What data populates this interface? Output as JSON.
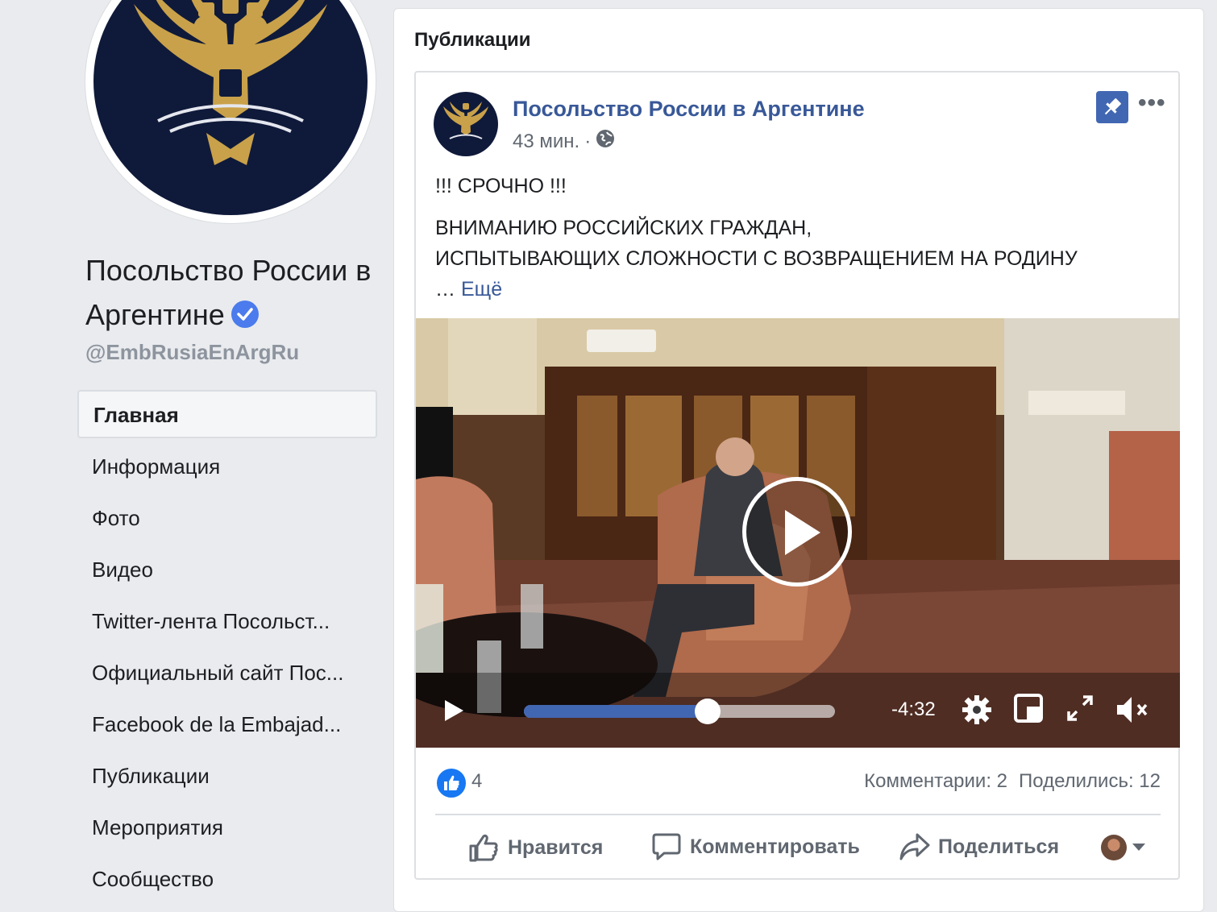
{
  "page": {
    "name": "Посольство России в Аргентине",
    "handle": "@EmbRusiaEnArgRu",
    "verified": true
  },
  "nav": {
    "items": [
      {
        "label": "Главная",
        "active": true
      },
      {
        "label": "Информация"
      },
      {
        "label": "Фото"
      },
      {
        "label": "Видео"
      },
      {
        "label": "Twitter-лента Посольст..."
      },
      {
        "label": "Официальный сайт Пос..."
      },
      {
        "label": "Facebook de la Embajad..."
      },
      {
        "label": "Публикации"
      },
      {
        "label": "Мероприятия"
      },
      {
        "label": "Сообщество"
      }
    ]
  },
  "publications": {
    "title": "Публикации"
  },
  "post": {
    "author": "Посольство России в Аргентине",
    "time": "43 мин.",
    "meta_separator": "·",
    "visibility_icon": "globe-icon",
    "pinned": true,
    "text_line1": "!!! СРОЧНО !!!",
    "text_line2": "ВНИМАНИЮ РОССИЙСКИХ ГРАЖДАН,",
    "text_line3": "ИСПЫТЫВАЮЩИХ СЛОЖНОСТИ С ВОЗВРАЩЕНИЕМ НА РОДИНУ",
    "ellipsis": "…",
    "see_more": "Ещё",
    "video": {
      "time_remaining": "-4:32",
      "progress": 0.59
    },
    "reactions": {
      "like_count": "4",
      "comments": "Комментарии: 2",
      "shares": "Поделились: 12"
    },
    "actions": {
      "like": "Нравится",
      "comment": "Комментировать",
      "share": "Поделиться"
    }
  },
  "colors": {
    "link": "#385898",
    "accent": "#4267b2",
    "background": "#e9ebee"
  }
}
